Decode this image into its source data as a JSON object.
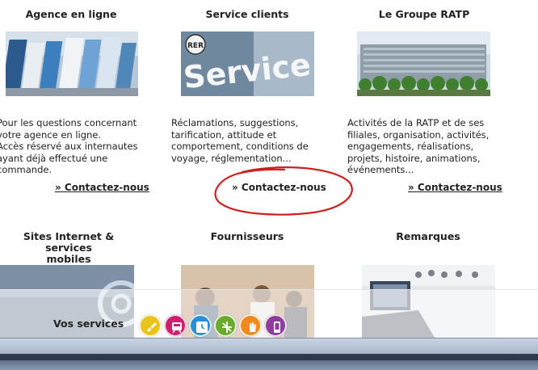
{
  "cards": [
    {
      "title": "Agence en ligne",
      "text": [
        "Pour les questions concernant",
        "votre agence en ligne.",
        "Accès réservé aux internautes",
        "ayant déjà effectué une",
        "commande."
      ],
      "link": "» Contactez-nous",
      "image": "brochure-rack-photo"
    },
    {
      "title": "Service clients",
      "text": [
        "Réclamations, suggestions,",
        "tarification, attitude et",
        "comportement, conditions de",
        "voyage, réglementation..."
      ],
      "link": "» Contactez-nous",
      "image": "service-sign-photo",
      "image_text": "Service",
      "image_badge": "RER"
    },
    {
      "title": "Le Groupe RATP",
      "text": [
        "Activités de la RATP et de ses",
        "filiales, organisation, activités,",
        "engagements, réalisations,",
        "projets, histoire, animations,",
        "événements..."
      ],
      "link": "» Contactez-nous",
      "image": "office-building-photo"
    },
    {
      "title": [
        "Sites Internet & services",
        "mobiles"
      ],
      "image": "internet-at-sign-photo"
    },
    {
      "title": "Fournisseurs",
      "image": "meeting-people-photo"
    },
    {
      "title": "Remarques",
      "image": "laptop-meeting-photo"
    }
  ],
  "annotation": {
    "shape": "red-hand-drawn-ellipse",
    "color": "#cc1f1f",
    "around": "Service clients contact link"
  },
  "services": {
    "label": "Vos services",
    "icons": [
      {
        "name": "ticket-icon",
        "color": "#e9c21c"
      },
      {
        "name": "train-icon",
        "color": "#d11f6e"
      },
      {
        "name": "clock-icon",
        "color": "#2a8fd6"
      },
      {
        "name": "route-icon",
        "color": "#6aab2d"
      },
      {
        "name": "hand-icon",
        "color": "#f08a1c"
      },
      {
        "name": "mobile-icon",
        "color": "#8e3d9c"
      }
    ]
  }
}
